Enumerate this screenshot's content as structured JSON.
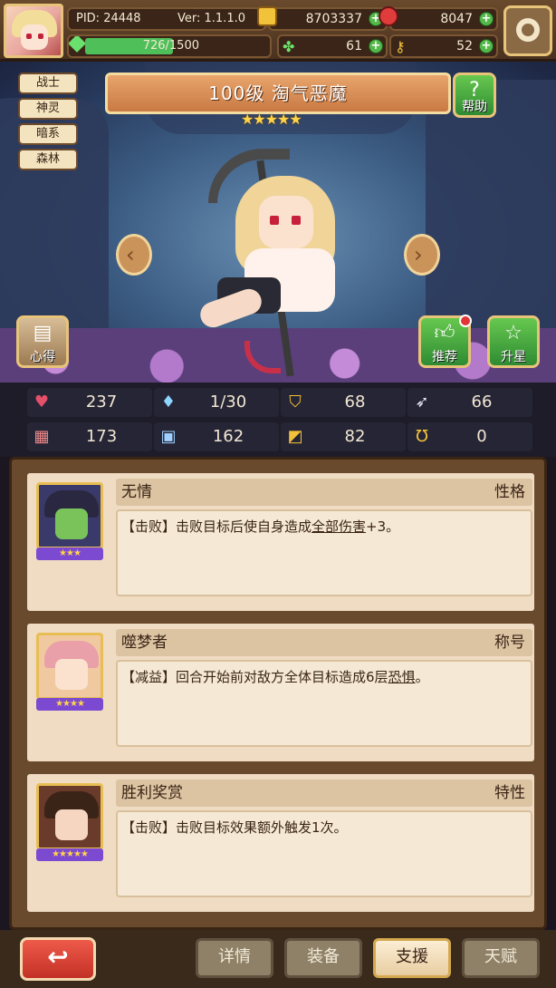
{
  "header": {
    "pid": "PID: 24448",
    "version": "Ver: 1.1.1.0",
    "gold": "8703337",
    "ruby": "8047",
    "xp_text": "726/1500",
    "xp_progress": 0.484,
    "clover": "61",
    "keys": "52"
  },
  "tags": [
    "战士",
    "神灵",
    "暗系",
    "森林"
  ],
  "hero": {
    "title": "100级  淘气恶魔",
    "stars": "★★★★★",
    "help_label": "帮助",
    "tips_label": "心得",
    "recommend_label": "推荐",
    "upgrade_label": "升星"
  },
  "stats": [
    "237",
    "1/30",
    "68",
    "66",
    "173",
    "162",
    "82",
    "0"
  ],
  "cards": [
    {
      "name": "无情",
      "type": "性格",
      "rarity": "★★★",
      "text_prefix": "【击败】击败目标后使自身造成",
      "text_link": "全部伤害",
      "text_suffix": "+3。"
    },
    {
      "name": "噬梦者",
      "type": "称号",
      "rarity": "★★★★",
      "text_prefix": "【减益】回合开始前对敌方全体目标造成6层",
      "text_link": "恐惧",
      "text_suffix": "。"
    },
    {
      "name": "胜利奖赏",
      "type": "特性",
      "rarity": "★★★★★",
      "text_prefix": "【击败】击败目标效果额外触发1次。",
      "text_link": "",
      "text_suffix": ""
    }
  ],
  "bottom": {
    "back_glyph": "↩",
    "tabs": [
      "详情",
      "装备",
      "支援",
      "天赋"
    ],
    "active_tab": "支援"
  }
}
